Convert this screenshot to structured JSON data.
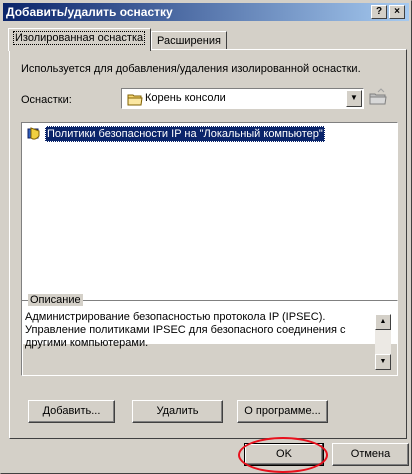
{
  "window": {
    "title": "Добавить/удалить оснастку",
    "help_glyph": "?",
    "close_glyph": "×"
  },
  "tabs": [
    {
      "label": "Изолированная оснастка",
      "active": true
    },
    {
      "label": "Расширения",
      "active": false
    }
  ],
  "panel": {
    "description": "Используется для добавления/удаления изолированной оснастки.",
    "snapins_label": "Оснастки:",
    "combo_value": "Корень консоли",
    "combo_icon": "folder-icon",
    "up_icon": "folder-up-icon"
  },
  "list": {
    "items": [
      {
        "label": "Политики безопасности IP на \"Локальный компьютер\"",
        "icon": "ip-security-policy-icon",
        "selected": true
      }
    ]
  },
  "description_group": {
    "legend": "Описание",
    "text": "Администрирование безопасностью протокола IP (IPSEC). Управление политиками IPSEC для безопасного соединения с другими компьютерами."
  },
  "buttons": {
    "add": "Добавить...",
    "remove": "Удалить",
    "about": "О программе...",
    "ok": "OK",
    "cancel": "Отмена"
  },
  "colors": {
    "titlebar_start": "#0a246a",
    "titlebar_end": "#a6caf0",
    "selection": "#0a246a",
    "highlight_circle": "#e8101c"
  }
}
